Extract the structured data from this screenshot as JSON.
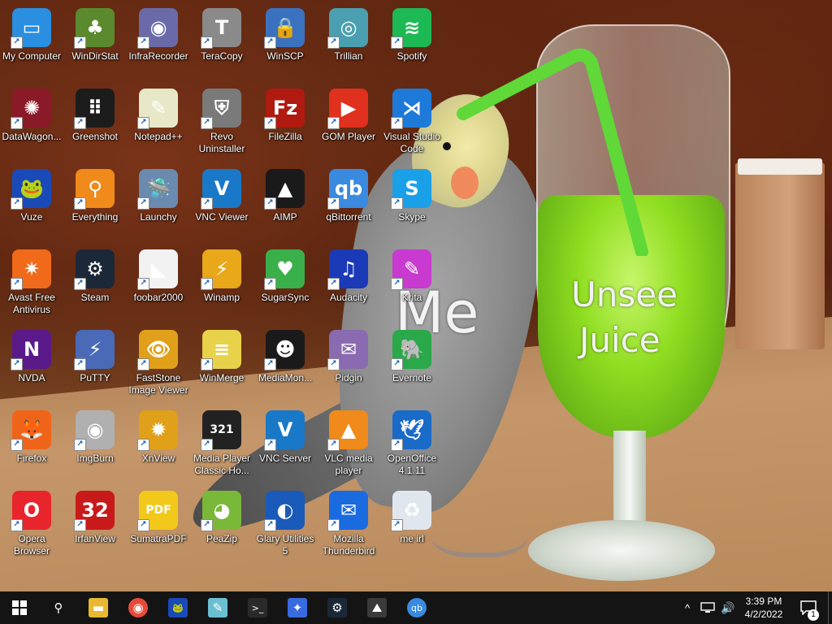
{
  "wallpaper": {
    "text_me": "Me",
    "text_unsee": "Unsee",
    "text_juice": "Juice"
  },
  "desktop_icons": [
    {
      "label": "My Computer",
      "icon": "computer-icon",
      "color": "#2a8fe0",
      "glyph": "▭"
    },
    {
      "label": "WinDirStat",
      "icon": "windirstat-icon",
      "color": "#5b8a2e",
      "glyph": "♣"
    },
    {
      "label": "InfraRecorder",
      "icon": "infrarecorder-icon",
      "color": "#6a6aa8",
      "glyph": "◉"
    },
    {
      "label": "TeraCopy",
      "icon": "teracopy-icon",
      "color": "#8a8a8a",
      "glyph": "T"
    },
    {
      "label": "WinSCP",
      "icon": "winscp-icon",
      "color": "#3a72c0",
      "glyph": "🔒"
    },
    {
      "label": "Trillian",
      "icon": "trillian-icon",
      "color": "#4aa0b0",
      "glyph": "◎"
    },
    {
      "label": "Spotify",
      "icon": "spotify-icon",
      "color": "#1db954",
      "glyph": "≋"
    },
    {
      "label": "DataWagon...",
      "icon": "datawagon-icon",
      "color": "#8a1a28",
      "glyph": "✺"
    },
    {
      "label": "Greenshot",
      "icon": "greenshot-icon",
      "color": "#1c1c1c",
      "glyph": "⠿"
    },
    {
      "label": "Notepad++",
      "icon": "notepadpp-icon",
      "color": "#e8e8c8",
      "glyph": "✎"
    },
    {
      "label": "Revo Uninstaller",
      "icon": "revo-uninstaller-icon",
      "color": "#7a7a7a",
      "glyph": "⛨"
    },
    {
      "label": "FileZilla",
      "icon": "filezilla-icon",
      "color": "#b01a10",
      "glyph": "Fz"
    },
    {
      "label": "GOM Player",
      "icon": "gom-player-icon",
      "color": "#e0301e",
      "glyph": "▶"
    },
    {
      "label": "Visual Studio Code",
      "icon": "vscode-icon",
      "color": "#1e7ad8",
      "glyph": "⋊"
    },
    {
      "label": "Vuze",
      "icon": "vuze-icon",
      "color": "#1a4ab8",
      "glyph": "🐸"
    },
    {
      "label": "Everything",
      "icon": "everything-icon",
      "color": "#f08a1a",
      "glyph": "⚲"
    },
    {
      "label": "Launchy",
      "icon": "launchy-icon",
      "color": "#6a8ab0",
      "glyph": "🛸"
    },
    {
      "label": "VNC Viewer",
      "icon": "vnc-viewer-icon",
      "color": "#1a78c8",
      "glyph": "V"
    },
    {
      "label": "AIMP",
      "icon": "aimp-icon",
      "color": "#1a1a1a",
      "glyph": "▲"
    },
    {
      "label": "qBittorrent",
      "icon": "qbittorrent-icon",
      "color": "#3a8ae0",
      "glyph": "qb"
    },
    {
      "label": "Skype",
      "icon": "skype-icon",
      "color": "#1aa0e8",
      "glyph": "S"
    },
    {
      "label": "Avast Free Antivirus",
      "icon": "avast-icon",
      "color": "#f06a1a",
      "glyph": "✷"
    },
    {
      "label": "Steam",
      "icon": "steam-icon",
      "color": "#1b2838",
      "glyph": "⚙"
    },
    {
      "label": "foobar2000",
      "icon": "foobar2000-icon",
      "color": "#f2f2f2",
      "glyph": "◣"
    },
    {
      "label": "Winamp",
      "icon": "winamp-icon",
      "color": "#e8a81a",
      "glyph": "⚡"
    },
    {
      "label": "SugarSync",
      "icon": "sugarsync-icon",
      "color": "#3ab04a",
      "glyph": "♥"
    },
    {
      "label": "Audacity",
      "icon": "audacity-icon",
      "color": "#1a3ab8",
      "glyph": "♫"
    },
    {
      "label": "Krita",
      "icon": "krita-icon",
      "color": "#c83ad0",
      "glyph": "✎"
    },
    {
      "label": "NVDA",
      "icon": "nvda-icon",
      "color": "#5a1a8a",
      "glyph": "N"
    },
    {
      "label": "PuTTY",
      "icon": "putty-icon",
      "color": "#4a6ab8",
      "glyph": "⚡"
    },
    {
      "label": "FastStone Image Viewer",
      "icon": "faststone-icon",
      "color": "#e0a01a",
      "glyph": "👁"
    },
    {
      "label": "WinMerge",
      "icon": "winmerge-icon",
      "color": "#e8d24a",
      "glyph": "≡"
    },
    {
      "label": "MediaMon...",
      "icon": "mediamonkey-icon",
      "color": "#1a1a1a",
      "glyph": "☻"
    },
    {
      "label": "Pidgin",
      "icon": "pidgin-icon",
      "color": "#8a6ab0",
      "glyph": "✉"
    },
    {
      "label": "Evernote",
      "icon": "evernote-icon",
      "color": "#2aa84a",
      "glyph": "🐘"
    },
    {
      "label": "Firefox",
      "icon": "firefox-icon",
      "color": "#f0641a",
      "glyph": "🦊"
    },
    {
      "label": "ImgBurn",
      "icon": "imgburn-icon",
      "color": "#b0b0b0",
      "glyph": "◉"
    },
    {
      "label": "XnView",
      "icon": "xnview-icon",
      "color": "#e0a01a",
      "glyph": "✹"
    },
    {
      "label": "Media Player Classic Ho...",
      "icon": "mpc-hc-icon",
      "color": "#222222",
      "glyph": "321"
    },
    {
      "label": "VNC Server",
      "icon": "vnc-server-icon",
      "color": "#1a78c8",
      "glyph": "V"
    },
    {
      "label": "VLC media player",
      "icon": "vlc-icon",
      "color": "#f08a1a",
      "glyph": "▲"
    },
    {
      "label": "OpenOffice 4.1.11",
      "icon": "openoffice-icon",
      "color": "#1a6ac8",
      "glyph": "🕊"
    },
    {
      "label": "Opera Browser",
      "icon": "opera-icon",
      "color": "#e8242c",
      "glyph": "O"
    },
    {
      "label": "IrfanView",
      "icon": "irfanview-icon",
      "color": "#c81a1a",
      "glyph": "32"
    },
    {
      "label": "SumatraPDF",
      "icon": "sumatrapdf-icon",
      "color": "#f2c81a",
      "glyph": "PDF"
    },
    {
      "label": "PeaZip",
      "icon": "peazip-icon",
      "color": "#7ab83a",
      "glyph": "◕"
    },
    {
      "label": "Glary Utilities 5",
      "icon": "glary-utilities-icon",
      "color": "#1a5ab8",
      "glyph": "◐"
    },
    {
      "label": "Mozilla Thunderbird",
      "icon": "thunderbird-icon",
      "color": "#1a6ae0",
      "glyph": "✉"
    },
    {
      "label": "me irl",
      "icon": "recycle-bin-icon",
      "color": "#dfe6ee",
      "glyph": "♻"
    }
  ],
  "taskbar": {
    "start_icon": "windows-start-icon",
    "apps": [
      {
        "icon": "search-icon",
        "glyph": "⚲",
        "color": "#141414"
      },
      {
        "icon": "file-explorer-icon",
        "glyph": "▬",
        "color": "#e8b830"
      },
      {
        "icon": "chrome-icon",
        "glyph": "◉",
        "color": "#e84a3a"
      },
      {
        "icon": "vuze-icon",
        "glyph": "🐸",
        "color": "#1a4ab8"
      },
      {
        "icon": "notepad-icon",
        "glyph": "✎",
        "color": "#6ac0d0"
      },
      {
        "icon": "terminal-icon",
        "glyph": ">_",
        "color": "#2a2a2a"
      },
      {
        "icon": "feather-app-icon",
        "glyph": "✦",
        "color": "#3a6ae0"
      },
      {
        "icon": "steam-icon",
        "glyph": "⚙",
        "color": "#1b2838"
      },
      {
        "icon": "photos-icon",
        "glyph": "⛰",
        "color": "#3a3a3a"
      },
      {
        "icon": "qbittorrent-icon",
        "glyph": "qb",
        "color": "#3a8ae0"
      }
    ],
    "tray_chevron": "^",
    "volume": "🔊",
    "time": "3:39 PM",
    "date": "4/2/2022",
    "notification_count": "1"
  }
}
